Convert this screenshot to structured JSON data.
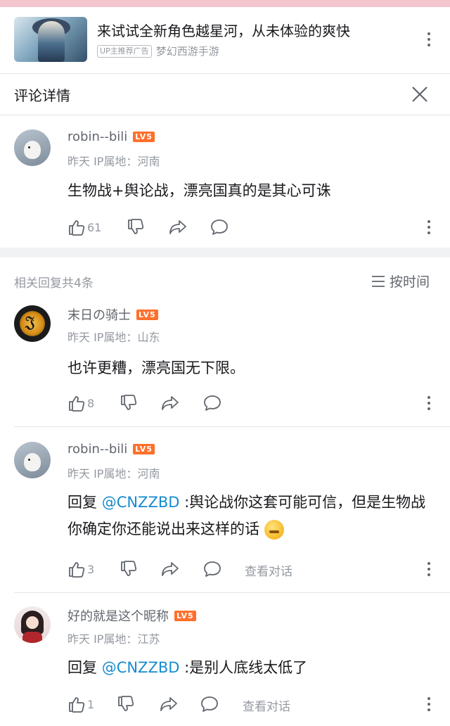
{
  "ad": {
    "title": "来试试全新角色越星河，从未体验的爽快",
    "badge": "UP主推荐广告",
    "source": "梦幻西游手游"
  },
  "header": {
    "title": "评论详情"
  },
  "main_comment": {
    "username": "robin--bili",
    "level": "LV5",
    "meta": "昨天  IP属地：河南",
    "content": "生物战+舆论战，漂亮国真的是其心可诛",
    "likes": "61"
  },
  "replies_header": {
    "count_label": "相关回复共4条",
    "sort_label": "按时间"
  },
  "replies": [
    {
      "username": "末日の骑士",
      "level": "LV5",
      "meta": "昨天  IP属地：山东",
      "content": "也许更糟，漂亮国无下限。",
      "likes": "8"
    },
    {
      "username": "robin--bili",
      "level": "LV5",
      "meta": "昨天  IP属地：河南",
      "reply_prefix": "回复 ",
      "mention": "@CNZZBD",
      "content": " :舆论战你这套可能可信，但是生物战你确定你还能说出来这样的话",
      "likes": "3",
      "view_conversation": "查看对话"
    },
    {
      "username": "好的就是这个昵称",
      "level": "LV5",
      "meta": "昨天  IP属地：江苏",
      "reply_prefix": "回复 ",
      "mention": "@CNZZBD",
      "content": " :是别人底线太低了",
      "likes": "1",
      "view_conversation": "查看对话"
    }
  ],
  "colors": {
    "accent": "#178bcf",
    "level_badge": "#ff6f2b",
    "top_bar": "#f4c4cf"
  }
}
